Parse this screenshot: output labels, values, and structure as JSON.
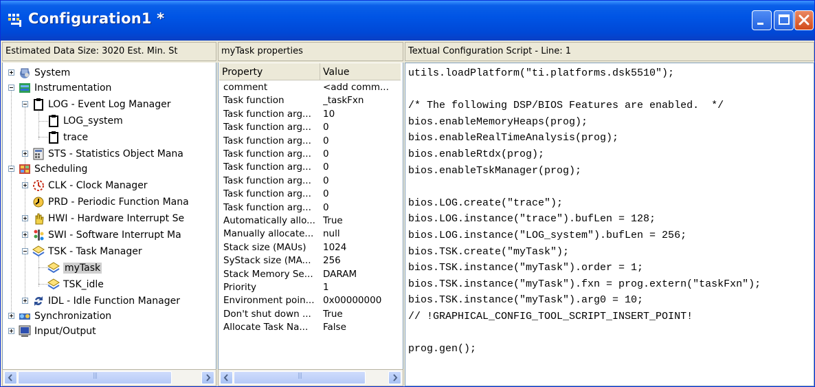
{
  "window": {
    "title": "Configuration1 *",
    "controls": [
      "minimize",
      "maximize",
      "close"
    ]
  },
  "tree_pane": {
    "header": "Estimated Data Size: 3020   Est. Min. St",
    "items": [
      {
        "label": "System",
        "icon": "system-icon",
        "expander": "plus"
      },
      {
        "label": "Instrumentation",
        "icon": "instrumentation-icon",
        "expander": "minus"
      },
      {
        "label": "LOG - Event Log Manager",
        "icon": "log-manager-icon",
        "expander": "minus"
      },
      {
        "label": "LOG_system",
        "icon": "log-object-icon"
      },
      {
        "label": "trace",
        "icon": "log-object-icon"
      },
      {
        "label": "STS - Statistics Object Mana",
        "icon": "sts-icon",
        "expander": "plus"
      },
      {
        "label": "Scheduling",
        "icon": "scheduling-icon",
        "expander": "minus"
      },
      {
        "label": "CLK - Clock Manager",
        "icon": "clock-icon",
        "expander": "plus"
      },
      {
        "label": "PRD - Periodic Function Mana",
        "icon": "prd-icon"
      },
      {
        "label": "HWI - Hardware Interrupt Se",
        "icon": "hwi-icon",
        "expander": "plus"
      },
      {
        "label": "SWI - Software Interrupt Ma",
        "icon": "swi-icon",
        "expander": "plus"
      },
      {
        "label": "TSK - Task Manager",
        "icon": "tsk-icon",
        "expander": "minus"
      },
      {
        "label": "myTask",
        "icon": "task-object-icon",
        "selected": true
      },
      {
        "label": "TSK_idle",
        "icon": "task-object-icon"
      },
      {
        "label": "IDL - Idle Function Manager",
        "icon": "idl-icon",
        "expander": "plus"
      },
      {
        "label": "Synchronization",
        "icon": "synchronization-icon",
        "expander": "plus"
      },
      {
        "label": "Input/Output",
        "icon": "input-output-icon",
        "expander": "plus"
      }
    ]
  },
  "properties_pane": {
    "header": "myTask properties",
    "columns": [
      "Property",
      "Value"
    ],
    "rows": [
      [
        "comment",
        "<add comm..."
      ],
      [
        "Task function",
        "_taskFxn"
      ],
      [
        "Task function arg...",
        "10"
      ],
      [
        "Task function arg...",
        "0"
      ],
      [
        "Task function arg...",
        "0"
      ],
      [
        "Task function arg...",
        "0"
      ],
      [
        "Task function arg...",
        "0"
      ],
      [
        "Task function arg...",
        "0"
      ],
      [
        "Task function arg...",
        "0"
      ],
      [
        "Task function arg...",
        "0"
      ],
      [
        "Automatically allo...",
        "True"
      ],
      [
        "Manually allocate...",
        "null"
      ],
      [
        "Stack size (MAUs)",
        "1024"
      ],
      [
        "SyStack size (MA...",
        "256"
      ],
      [
        "Stack Memory Se...",
        "DARAM"
      ],
      [
        "Priority",
        "1"
      ],
      [
        "Environment poin...",
        "0x00000000"
      ],
      [
        "Don't shut down ...",
        "True"
      ],
      [
        "Allocate Task Na...",
        "False"
      ]
    ]
  },
  "script_pane": {
    "header": "Textual Configuration Script - Line: 1",
    "lines": [
      "utils.loadPlatform(\"ti.platforms.dsk5510\");",
      "",
      "/* The following DSP/BIOS Features are enabled.  */",
      "bios.enableMemoryHeaps(prog);",
      "bios.enableRealTimeAnalysis(prog);",
      "bios.enableRtdx(prog);",
      "bios.enableTskManager(prog);",
      "",
      "bios.LOG.create(\"trace\");",
      "bios.LOG.instance(\"trace\").bufLen = 128;",
      "bios.LOG.instance(\"LOG_system\").bufLen = 256;",
      "bios.TSK.create(\"myTask\");",
      "bios.TSK.instance(\"myTask\").order = 1;",
      "bios.TSK.instance(\"myTask\").fxn = prog.extern(\"taskFxn\");",
      "bios.TSK.instance(\"myTask\").arg0 = 10;",
      "// !GRAPHICAL_CONFIG_TOOL_SCRIPT_INSERT_POINT!",
      "",
      "prog.gen();"
    ]
  },
  "scrollbar_glyph": "|||"
}
